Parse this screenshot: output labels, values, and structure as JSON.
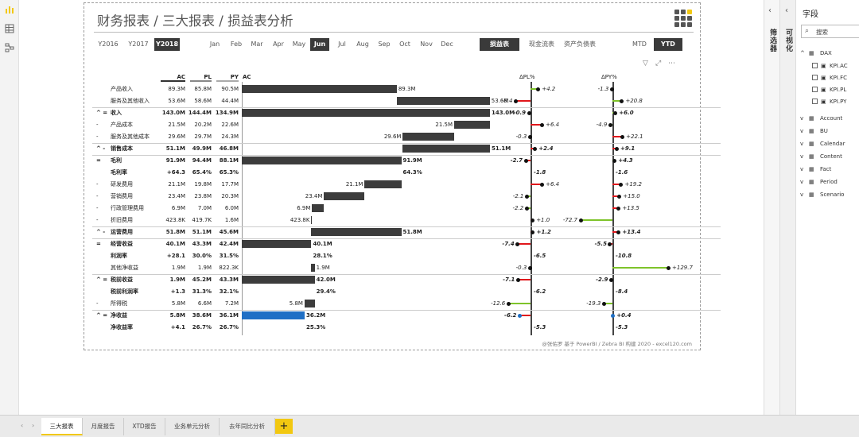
{
  "report_title": "财务报表 / 三大报表 / 损益表分析",
  "slicers": {
    "years": [
      {
        "label": "Y2016",
        "active": false
      },
      {
        "label": "Y2017",
        "active": false
      },
      {
        "label": "Y2018",
        "active": true
      }
    ],
    "months": [
      {
        "label": "Jan",
        "active": false
      },
      {
        "label": "Feb",
        "active": false
      },
      {
        "label": "Mar",
        "active": false
      },
      {
        "label": "Apr",
        "active": false
      },
      {
        "label": "May",
        "active": false
      },
      {
        "label": "Jun",
        "active": true
      },
      {
        "label": "Jul",
        "active": false
      },
      {
        "label": "Aug",
        "active": false
      },
      {
        "label": "Sep",
        "active": false
      },
      {
        "label": "Oct",
        "active": false
      },
      {
        "label": "Nov",
        "active": false
      },
      {
        "label": "Dec",
        "active": false
      }
    ],
    "reports": [
      {
        "label": "损益表",
        "active": true
      },
      {
        "label": "现金流表",
        "active": false
      },
      {
        "label": "资产负债表",
        "active": false
      }
    ],
    "modes": [
      {
        "label": "MTD",
        "active": false
      },
      {
        "label": "YTD",
        "active": true
      }
    ]
  },
  "table": {
    "headers": {
      "ac": "AC",
      "pl": "PL",
      "py": "PY",
      "chart_ac": "AC",
      "chart_dpl": "ΔPL%",
      "chart_dpy": "ΔPY%"
    },
    "rows": [
      {
        "prefix": "",
        "name": "产品收入",
        "bold": false,
        "ac": "89.3M",
        "pl": "85.8M",
        "py": "90.5M",
        "wf_label": "89.3M",
        "dpl": 4.2,
        "dpl_label": "+4.2",
        "dpy": -1.3,
        "dpy_label": "-1.3"
      },
      {
        "prefix": "",
        "name": "服务及其他收入",
        "bold": false,
        "ac": "53.6M",
        "pl": "58.6M",
        "py": "44.4M",
        "wf_label": "53.6M",
        "dpl": -8.4,
        "dpl_label": "-8.4",
        "dpy": 20.8,
        "dpy_label": "+20.8"
      },
      {
        "prefix": "^ =",
        "name": "收入",
        "bold": true,
        "ac": "143.0M",
        "pl": "144.4M",
        "py": "134.9M",
        "wf_label": "143.0M",
        "dpl": -0.9,
        "dpl_label": "-0.9",
        "dpy": 6.0,
        "dpy_label": "+6.0"
      },
      {
        "prefix": "-",
        "name": "产品成本",
        "bold": false,
        "ac": "21.5M",
        "pl": "20.2M",
        "py": "22.6M",
        "wf_label": "21.5M",
        "dpl": 6.4,
        "dpl_label": "+6.4",
        "dpy": -4.9,
        "dpy_label": "-4.9"
      },
      {
        "prefix": "-",
        "name": "服务及其他成本",
        "bold": false,
        "ac": "29.6M",
        "pl": "29.7M",
        "py": "24.3M",
        "wf_label": "29.6M",
        "dpl": -0.3,
        "dpl_label": "-0.3",
        "dpy": 22.1,
        "dpy_label": "+22.1"
      },
      {
        "prefix": "^ -",
        "name": "销售成本",
        "bold": true,
        "ac": "51.1M",
        "pl": "49.9M",
        "py": "46.8M",
        "wf_label": "51.1M",
        "dpl": 2.4,
        "dpl_label": "+2.4",
        "dpy": 9.1,
        "dpy_label": "+9.1"
      },
      {
        "prefix": "=",
        "name": "毛利",
        "bold": true,
        "ac": "91.9M",
        "pl": "94.4M",
        "py": "88.1M",
        "wf_label": "91.9M",
        "dpl": -2.7,
        "dpl_label": "-2.7",
        "dpy": 4.3,
        "dpy_label": "+4.3"
      },
      {
        "prefix": "",
        "name": "毛利率",
        "bold": true,
        "ac": "+64.3",
        "pl": "65.4%",
        "py": "65.3%",
        "wf_label": "64.3%",
        "dpl": null,
        "dpl_label": "-1.8",
        "dpy": null,
        "dpy_label": "-1.6"
      },
      {
        "prefix": "-",
        "name": "研发费用",
        "bold": false,
        "ac": "21.1M",
        "pl": "19.8M",
        "py": "17.7M",
        "wf_label": "21.1M",
        "dpl": 6.4,
        "dpl_label": "+6.4",
        "dpy": 19.2,
        "dpy_label": "+19.2"
      },
      {
        "prefix": "-",
        "name": "营销费用",
        "bold": false,
        "ac": "23.4M",
        "pl": "23.8M",
        "py": "20.3M",
        "wf_label": "23.4M",
        "dpl": -2.1,
        "dpl_label": "-2.1",
        "dpy": 15.0,
        "dpy_label": "+15.0"
      },
      {
        "prefix": "-",
        "name": "行政管理费用",
        "bold": false,
        "ac": "6.9M",
        "pl": "7.0M",
        "py": "6.0M",
        "wf_label": "6.9M",
        "dpl": -2.2,
        "dpl_label": "-2.2",
        "dpy": 13.5,
        "dpy_label": "+13.5"
      },
      {
        "prefix": "-",
        "name": "折旧费用",
        "bold": false,
        "ac": "423.8K",
        "pl": "419.7K",
        "py": "1.6M",
        "wf_label": "423.8K",
        "dpl": 1.0,
        "dpl_label": "+1.0",
        "dpy": -72.7,
        "dpy_label": "-72.7"
      },
      {
        "prefix": "^ -",
        "name": "运营费用",
        "bold": true,
        "ac": "51.8M",
        "pl": "51.1M",
        "py": "45.6M",
        "wf_label": "51.8M",
        "dpl": 1.2,
        "dpl_label": "+1.2",
        "dpy": 13.4,
        "dpy_label": "+13.4"
      },
      {
        "prefix": "=",
        "name": "经营收益",
        "bold": true,
        "ac": "40.1M",
        "pl": "43.3M",
        "py": "42.4M",
        "wf_label": "40.1M",
        "dpl": -7.4,
        "dpl_label": "-7.4",
        "dpy": -5.5,
        "dpy_label": "-5.5"
      },
      {
        "prefix": "",
        "name": "利润率",
        "bold": true,
        "ac": "+28.1",
        "pl": "30.0%",
        "py": "31.5%",
        "wf_label": "28.1%",
        "dpl": null,
        "dpl_label": "-6.5",
        "dpy": null,
        "dpy_label": "-10.8"
      },
      {
        "prefix": "",
        "name": "其他净收益",
        "bold": false,
        "ac": "1.9M",
        "pl": "1.9M",
        "py": "822.3K",
        "wf_label": "1.9M",
        "dpl": -0.3,
        "dpl_label": "-0.3",
        "dpy": 129.7,
        "dpy_label": "+129.7"
      },
      {
        "prefix": "^ =",
        "name": "税前收益",
        "bold": true,
        "ac": "1.9M",
        "pl": "45.2M",
        "py": "43.3M",
        "wf_label": "42.0M",
        "dpl": -7.1,
        "dpl_label": "-7.1",
        "dpy": -2.9,
        "dpy_label": "-2.9"
      },
      {
        "prefix": "",
        "name": "税前利润率",
        "bold": true,
        "ac": "+1.3",
        "pl": "31.3%",
        "py": "32.1%",
        "wf_label": "29.4%",
        "dpl": null,
        "dpl_label": "-6.2",
        "dpy": null,
        "dpy_label": "-8.4"
      },
      {
        "prefix": "-",
        "name": "所得税",
        "bold": false,
        "ac": "5.8M",
        "pl": "6.6M",
        "py": "7.2M",
        "wf_label": "5.8M",
        "dpl": -12.6,
        "dpl_label": "-12.6",
        "dpy": -19.3,
        "dpy_label": "-19.3"
      },
      {
        "prefix": "^ =",
        "name": "净收益",
        "bold": true,
        "ac": "5.8M",
        "pl": "38.6M",
        "py": "36.1M",
        "wf_label": "36.2M",
        "dpl": -6.2,
        "dpl_label": "-6.2",
        "dpy": 0.4,
        "dpy_label": "+0.4"
      },
      {
        "prefix": "",
        "name": "净收益率",
        "bold": true,
        "ac": "+4.1",
        "pl": "26.7%",
        "py": "26.7%",
        "wf_label": "25.3%",
        "dpl": null,
        "dpl_label": "-5.3",
        "dpy": null,
        "dpy_label": "-5.3"
      }
    ]
  },
  "credit": "@张佑罗 基于 PowerBI / Zebra BI 构建 2020 - excel120.com",
  "colors": {
    "bar": "#3c3c3c",
    "net": "#1f6fc5",
    "pos": "#7ec32a",
    "neg": "#e0161b",
    "accent": "#f2c811"
  },
  "pages": {
    "tabs": [
      {
        "label": "三大报表",
        "active": true
      },
      {
        "label": "月度报告",
        "active": false
      },
      {
        "label": "XTD报告",
        "active": false
      },
      {
        "label": "业务单元分析",
        "active": false
      },
      {
        "label": "去年同比分析",
        "active": false
      }
    ],
    "add": "+"
  },
  "filters_label": "筛选器",
  "visual_label": "可视化",
  "fields": {
    "title": "字段",
    "search_placeholder": "搜索",
    "tables": [
      {
        "name": "DAX",
        "expanded": true,
        "measures": [
          "KPI.AC",
          "KPI.FC",
          "KPI.PL",
          "KPI.PY"
        ]
      },
      {
        "name": "Account",
        "expanded": false
      },
      {
        "name": "BU",
        "expanded": false
      },
      {
        "name": "Calendar",
        "expanded": false
      },
      {
        "name": "Content",
        "expanded": false
      },
      {
        "name": "Fact",
        "expanded": false
      },
      {
        "name": "Period",
        "expanded": false
      },
      {
        "name": "Scenario",
        "expanded": false
      }
    ]
  }
}
